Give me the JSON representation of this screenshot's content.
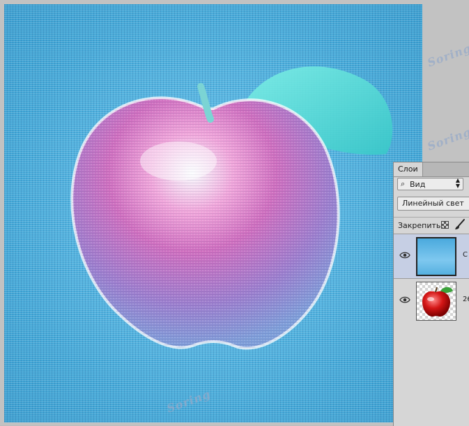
{
  "layers_panel": {
    "tab_label": "Слои",
    "filter_kind": "Вид",
    "blend_mode": "Линейный свет",
    "lock_label": "Закрепить:",
    "layers": [
      {
        "name": "С",
        "selected": true,
        "visible": true,
        "thumbnail": "blue-texture"
      },
      {
        "name": "26",
        "selected": false,
        "visible": true,
        "thumbnail": "apple"
      }
    ]
  },
  "watermarks": [
    "Soring",
    "Soring",
    "Soring",
    "Soring"
  ],
  "icons": {
    "filter": "magnifier-icon",
    "spinner": "updown-arrows-icon",
    "lock_pixels": "checker-lock-icon",
    "lock_paint": "brush-icon",
    "visibility": "eye-icon"
  }
}
